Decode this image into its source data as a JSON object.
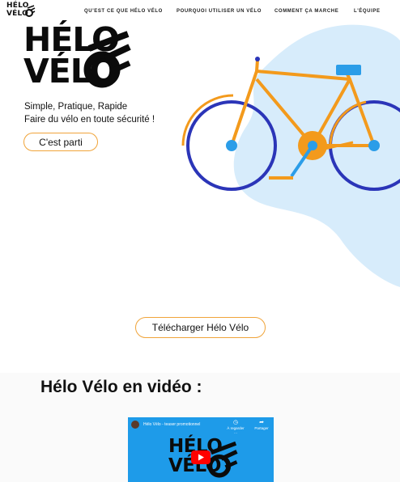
{
  "nav": {
    "logo_line1": "HÉLO",
    "logo_line2": "VÉLO",
    "items": [
      {
        "label": "QU'EST CE QUE HÉLO VÉLO"
      },
      {
        "label": "POURQUOI UTILISER UN VÉLO"
      },
      {
        "label": "COMMENT ÇA MARCHE"
      },
      {
        "label": "L'ÉQUIPE"
      }
    ]
  },
  "hero": {
    "title_line1": "HÉLO",
    "title_line2": "VÉLO",
    "tagline_line1": "Simple, Pratique, Rapide",
    "tagline_line2": "Faire du vélo en toute sécurité !",
    "cta_label": "C'est parti"
  },
  "download": {
    "label": "Télécharger Hélo Vélo"
  },
  "video_section": {
    "heading": "Hélo Vélo en vidéo :",
    "video": {
      "title": "Hélo Vélo - teaser promotionnel",
      "watch_later": "À regarder ...",
      "share": "Partager",
      "logo_line1": "HÉLO",
      "logo_line2": "VÉLO"
    }
  },
  "colors": {
    "accent_orange": "#f0a43a",
    "bike_orange": "#f39a1c",
    "wheel_blue": "#2b35b8",
    "light_blue_blob": "#d7ecfb",
    "video_bg": "#1e9be9"
  },
  "icons": {
    "logo_bike": "bike-icon",
    "video_play": "play-icon",
    "video_clock": "clock-icon",
    "video_share": "share-icon"
  }
}
